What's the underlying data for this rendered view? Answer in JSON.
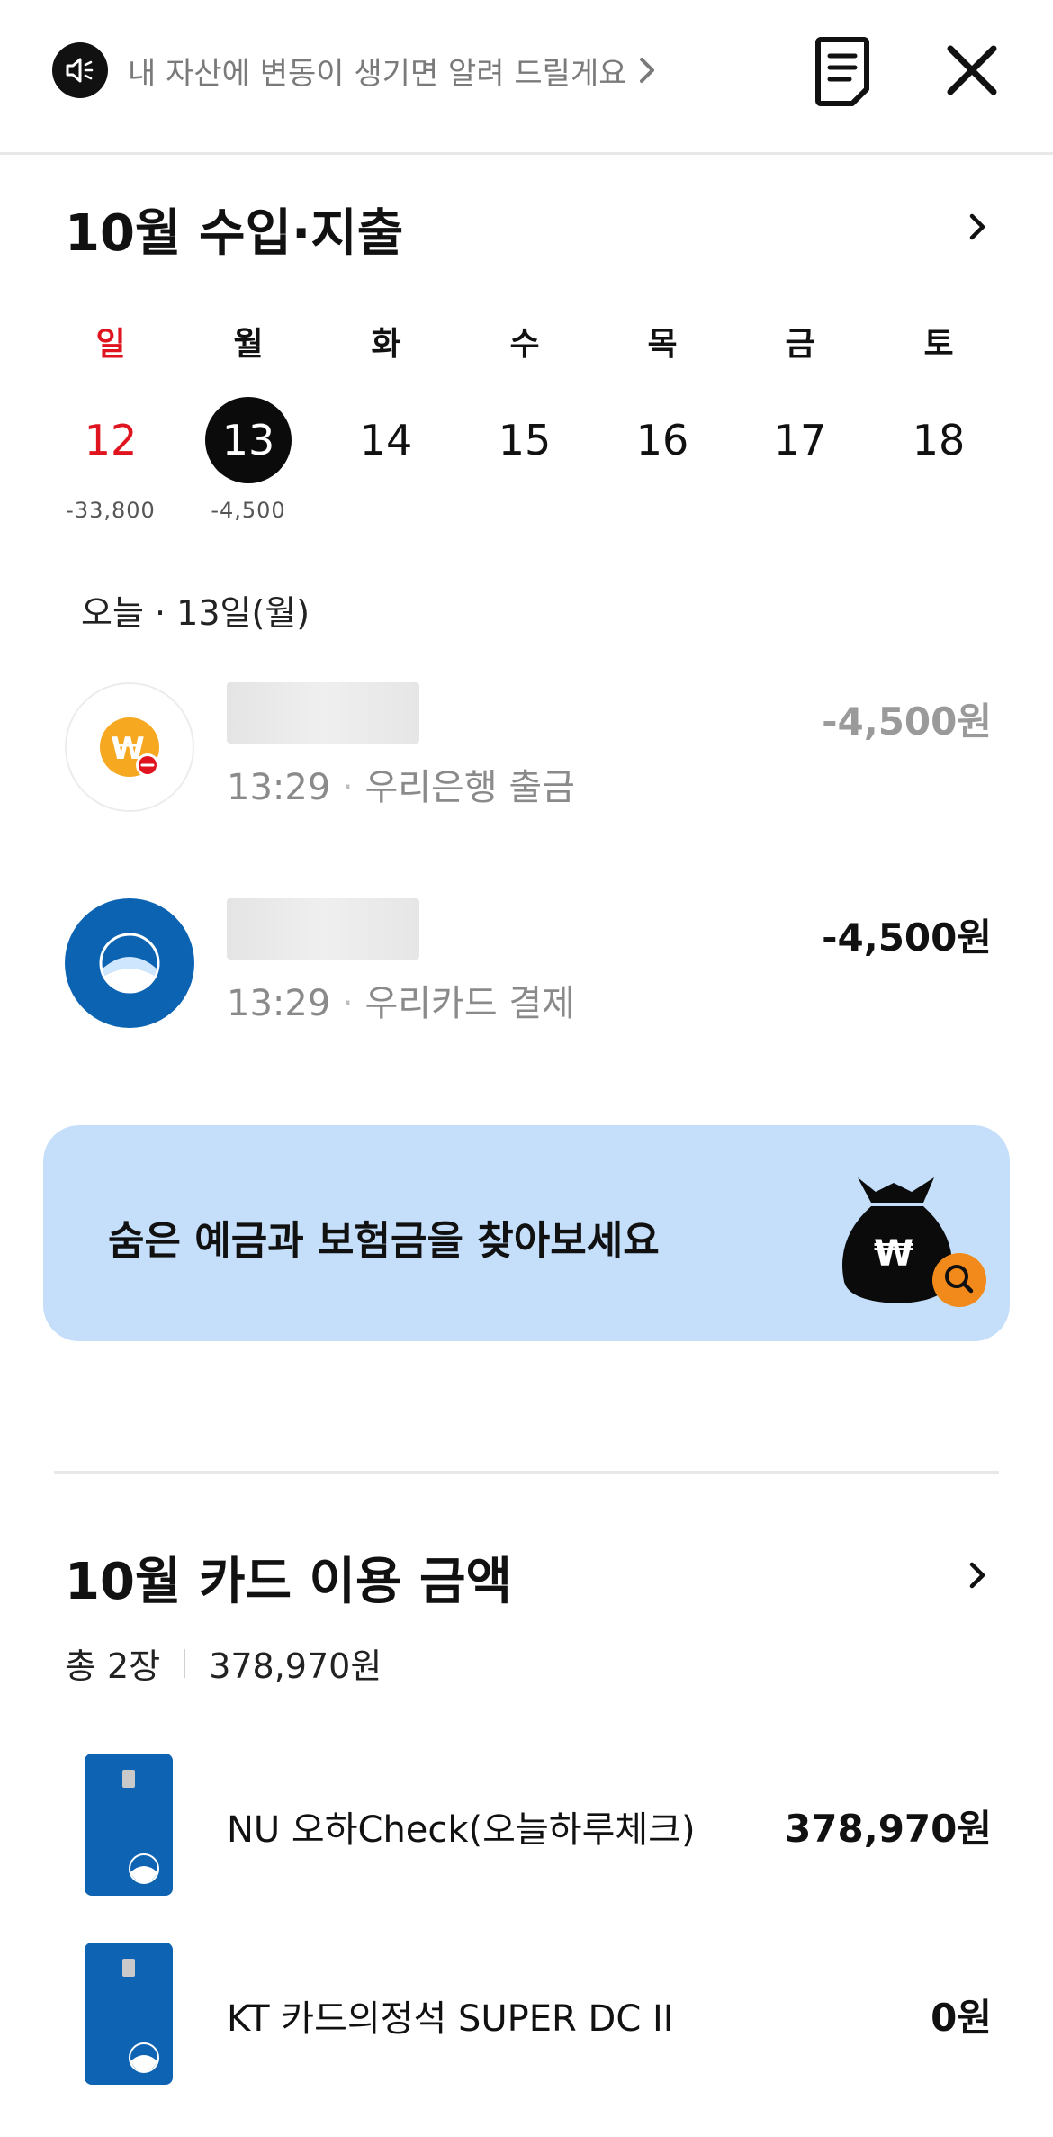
{
  "header": {
    "notice_text": "내 자산에 변동이 생기면 알려 드릴게요"
  },
  "income_section": {
    "title": "10월 수입·지출"
  },
  "calendar": {
    "days": [
      {
        "dow": "일",
        "date": "12",
        "amount": "-33,800"
      },
      {
        "dow": "월",
        "date": "13",
        "amount": "-4,500"
      },
      {
        "dow": "화",
        "date": "14",
        "amount": ""
      },
      {
        "dow": "수",
        "date": "15",
        "amount": ""
      },
      {
        "dow": "목",
        "date": "16",
        "amount": ""
      },
      {
        "dow": "금",
        "date": "17",
        "amount": ""
      },
      {
        "dow": "토",
        "date": "18",
        "amount": ""
      }
    ]
  },
  "today": {
    "label": "오늘 · 13일(월)"
  },
  "transactions": [
    {
      "time": "13:29",
      "desc": "우리은행 출금",
      "amount": "-4,500원",
      "amount_color": "#9a9a9a"
    },
    {
      "time": "13:29",
      "desc": "우리카드 결제",
      "amount": "-4,500원",
      "amount_color": "#111111"
    }
  ],
  "banner": {
    "text": "숨은 예금과 보험금을 찾아보세요",
    "bag_symbol": "₩"
  },
  "cards_section": {
    "title": "10월 카드 이용 금액",
    "count": "총 2장",
    "total": "378,970원",
    "cards": [
      {
        "name": "NU 오하Check(오늘하루체크)",
        "amount": "378,970원"
      },
      {
        "name": "KT 카드의정석 SUPER DC II",
        "amount": "0원"
      }
    ]
  },
  "colors": {
    "sunday": "#e0141e",
    "banner_bg": "#c5dffb",
    "card_blue": "#0f63b3",
    "accent_orange": "#f28a1b"
  }
}
